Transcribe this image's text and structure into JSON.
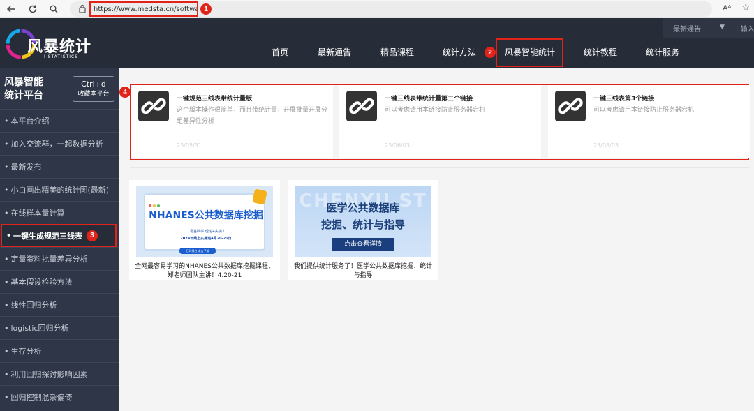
{
  "browser": {
    "url": "https://www.medsta.cn/software",
    "reader_label": "Aᴬ",
    "badge1": "1"
  },
  "header": {
    "logo_text": "风暴统计",
    "logo_sub": "I STATISTICS",
    "notice_select": "最新通告",
    "search_hint": "输入关",
    "nav": [
      "首页",
      "最新通告",
      "精品课程",
      "统计方法",
      "风暴智能统计",
      "统计教程",
      "统计服务"
    ],
    "badge2": "2"
  },
  "sidebar": {
    "title_line1": "风暴智能",
    "title_line2": "统计平台",
    "bookmark_key": "Ctrl+d",
    "bookmark_label": "收藏本平台",
    "items": [
      "本平台介绍",
      "加入交流群，一起数据分析",
      "最新发布",
      "小白画出精美的统计图(最新)",
      "在线样本量计算",
      "一键生成规范三线表",
      "定量资料批量差异分析",
      "基本假设检验方法",
      "线性回归分析",
      "logistic回归分析",
      "生存分析",
      "利用回归探讨影响因素",
      "回归控制混杂偏倚"
    ],
    "active_index": 5,
    "badge3": "3"
  },
  "cards": {
    "badge4": "4",
    "items": [
      {
        "title": "一键规范三线表带统计量版",
        "desc": "这个版本操作很简单，而且带统计量，开展批量开展分组差异性分析",
        "date": "23/05/31"
      },
      {
        "title": "一键三线表带统计量第二个链接",
        "desc": "可以考虑请用本链接防止服务器宕机",
        "date": "23/06/03"
      },
      {
        "title": "一键三线表第3个链接",
        "desc": "可以考虑请用本链接防止服务器宕机",
        "date": "23/08/03"
      }
    ]
  },
  "promos": [
    {
      "title": "NHANES公共数据库挖掘",
      "line1": "（ 零基础学 理论+实操 ）",
      "line2": "2024年线上实操班4月20-21日",
      "button": "扫码报名 点击了解",
      "caption": "全网最容易学习的NHANES公共数据库挖掘课程，郑老师团队主讲！4.20-21"
    },
    {
      "ghost": "CHENYU ST",
      "title1": "医学公共数据库",
      "title2": "挖掘、统计与指导",
      "button": "点击查看详情",
      "caption": "我们提供统计服务了！医学公共数据库挖掘、统计与指导"
    }
  ],
  "colors": {
    "highlight": "#e2231a",
    "header_bg": "#262c38",
    "sidebar_bg": "#2e3648",
    "content_bg": "#f4f4f4"
  }
}
